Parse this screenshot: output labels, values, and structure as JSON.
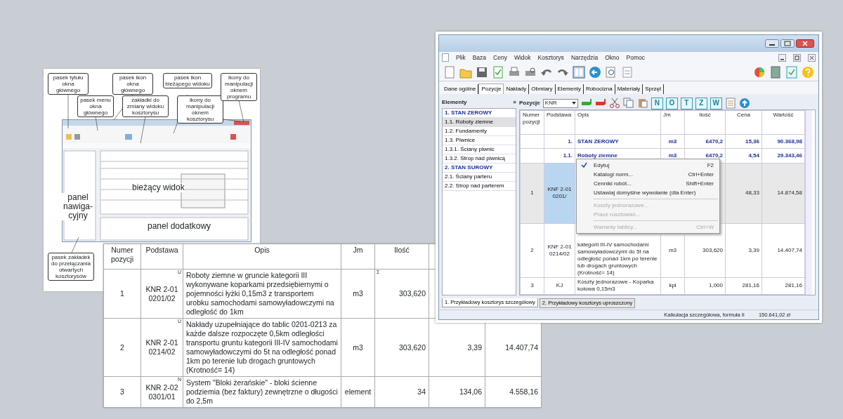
{
  "diagram": {
    "callouts": [
      "pasek tytułu okna głównego",
      "pasek menu okna głównego",
      "pasek ikon okna głównego",
      "zakładki do zmiany widoku kosztorysu",
      "pasek ikon bieżącego widoku",
      "ikony do manipulacji oknem kosztorysu",
      "ikony do manipulacji oknem programu",
      "pasek zakładek do przełączania otwartych kosztorysów"
    ],
    "labels": [
      "bieżący widok",
      "panel nawiga-cyjny",
      "panel dodatkowy"
    ]
  },
  "app_window": {
    "menu": [
      "Plik",
      "Baza",
      "Ceny",
      "Widok",
      "Kosztorys",
      "Narzędzia",
      "Okno",
      "Pomoc"
    ],
    "tabs": [
      {
        "label": "Dane ogólne",
        "selected": false
      },
      {
        "label": "Pozycje",
        "selected": true
      },
      {
        "label": "Nakłady",
        "selected": false
      },
      {
        "label": "Obmiary",
        "selected": false
      },
      {
        "label": "Elementy",
        "selected": false
      },
      {
        "label": "Robocizna",
        "selected": false
      },
      {
        "label": "Materiały",
        "selected": false
      },
      {
        "label": "Sprzęt",
        "selected": false
      }
    ],
    "elements_panel": {
      "title": "Elementy",
      "close": "×",
      "items": [
        {
          "label": "1. STAN ZEROWY",
          "kind": "group",
          "selected": false
        },
        {
          "label": "1.1. Roboty ziemne",
          "kind": "item",
          "selected": true
        },
        {
          "label": "1.2. Fundamenty",
          "kind": "item",
          "selected": false
        },
        {
          "label": "1.3. Piwnice",
          "kind": "item",
          "selected": false
        },
        {
          "label": "1.3.1. Ściany piwnic",
          "kind": "item",
          "selected": false
        },
        {
          "label": "1.3.2. Strop nad piwnicą",
          "kind": "item",
          "selected": false
        },
        {
          "label": "2. STAN SUROWY",
          "kind": "group",
          "selected": false
        },
        {
          "label": "2.1. Ściany parteru",
          "kind": "item",
          "selected": false
        },
        {
          "label": "2.2. Strop nad parterem",
          "kind": "item",
          "selected": false
        }
      ]
    },
    "grid_toolbar": {
      "label": "Pozycje",
      "dropdown": "KNR",
      "letter_buttons": [
        "N",
        "O",
        "T",
        "Z",
        "W"
      ]
    },
    "grid": {
      "columns": [
        "Numer pozycji",
        "Podstawa",
        "Opis",
        "Jm",
        "Ilość",
        "Cena",
        "Wartość"
      ],
      "rows": [
        {
          "kind": "group",
          "selected": false,
          "cells": {
            "basis": "1.",
            "description": "STAN ZEROWY",
            "unit": "m3",
            "quantity": "6470,2",
            "price": "15,36",
            "value": "90.368,98"
          }
        },
        {
          "kind": "group",
          "selected": false,
          "cells": {
            "basis": "1.1.",
            "description": "Roboty ziemne",
            "unit": "m3",
            "quantity": "6470,2",
            "price": "4,54",
            "value": "29.343,46"
          }
        },
        {
          "kind": "item",
          "selected": true,
          "cells": {
            "number": "1",
            "basis": "KNF 2-01 0201/",
            "price": "48,33",
            "value": "14.874,58"
          }
        },
        {
          "kind": "item",
          "selected": false,
          "cells": {
            "number": "2",
            "basis": "KNF 2-01 0214/02",
            "description": "kategorii III-IV samochodami samowyładowczymi do 5t na odległość ponad 1km po terenie lub drogach gruntowych (Krotność= 14)",
            "unit": "m3",
            "quantity": "303,620",
            "price": "3,39",
            "value": "14.407,74"
          }
        },
        {
          "kind": "item",
          "selected": false,
          "cells": {
            "number": "3",
            "basis": "KJ",
            "description": "Koszty jednorazowe - Koparka kołowa 0,15m3",
            "unit": "kpl",
            "quantity": "1,000",
            "price": "281,16",
            "value": "281,16"
          }
        }
      ]
    },
    "context_menu": [
      {
        "kind": "command",
        "label": "Edytuj",
        "shortcut": "F2",
        "checked": true,
        "disabled": false
      },
      {
        "kind": "command",
        "label": "Katalogi norm...",
        "shortcut": "Ctrl+Enter",
        "checked": false,
        "disabled": false
      },
      {
        "kind": "command",
        "label": "Cenniki robót...",
        "shortcut": "Shift+Enter",
        "checked": false,
        "disabled": false
      },
      {
        "kind": "command",
        "label": "Ustawiaj domyślne wywołanie (dla Enter)",
        "checked": false,
        "disabled": false
      },
      {
        "kind": "separator"
      },
      {
        "kind": "command",
        "label": "Koszty jednorazowe...",
        "checked": false,
        "disabled": true
      },
      {
        "kind": "command",
        "label": "Prace rusztowań...",
        "checked": false,
        "disabled": true
      },
      {
        "kind": "separator"
      },
      {
        "kind": "command",
        "label": "Warianty tablicy...",
        "shortcut": "Ctrl+W",
        "checked": false,
        "disabled": true
      }
    ],
    "sheet_tabs": [
      {
        "label": "1. Przykładowy kosztorys szczegółowy",
        "selected": true
      },
      {
        "label": "2. Przykładowy kosztorys uproszczony",
        "selected": false
      }
    ],
    "status_bar": [
      "Kalkulacja szczegółowa, formuła II",
      "150.641,02 zł"
    ]
  },
  "detail_table": {
    "columns": [
      "Numer pozycji",
      "Podstawa",
      "Opis",
      "Jm",
      "Ilość"
    ],
    "rows": [
      {
        "cells": {
          "number": "1",
          "basis": "KNR 2-01 0201/02",
          "basis_marker": "U",
          "description": "Roboty ziemne w gruncie kategorii III wykonywane koparkami przedsiębiernymi o pojemności łyżki 0,15m3 z transportem urobku samochodami samowyładowczymi na odległość do 1km",
          "unit": "m3",
          "quantity_marker": "Σ",
          "quantity": "303,620"
        }
      },
      {
        "cells": {
          "number": "2",
          "basis": "KNR 2-01 0214/02",
          "basis_marker": "U",
          "description": "Nakłady uzupełniające do tablic 0201-0213 za każde dalsze rozpoczęte 0,5km odległości transportu gruntu kategorii III-IV samochodami samowyładowczymi do 5t na odległość ponad 1km po terenie lub drogach gruntowych (Krotność= 14)",
          "unit": "m3",
          "quantity": "303,620",
          "price": "3,39",
          "value": "14.407,74"
        }
      },
      {
        "cells": {
          "number": "3",
          "basis": "KNR 2-02 0301/01",
          "basis_marker": "N",
          "description": "System \"Bloki żerańskie\" - bloki ścienne podziemia (bez faktury) zewnętrzne o długości do 2,5m",
          "unit": "element",
          "quantity": "34",
          "price": "134,06",
          "value": "4.558,16"
        }
      }
    ]
  }
}
